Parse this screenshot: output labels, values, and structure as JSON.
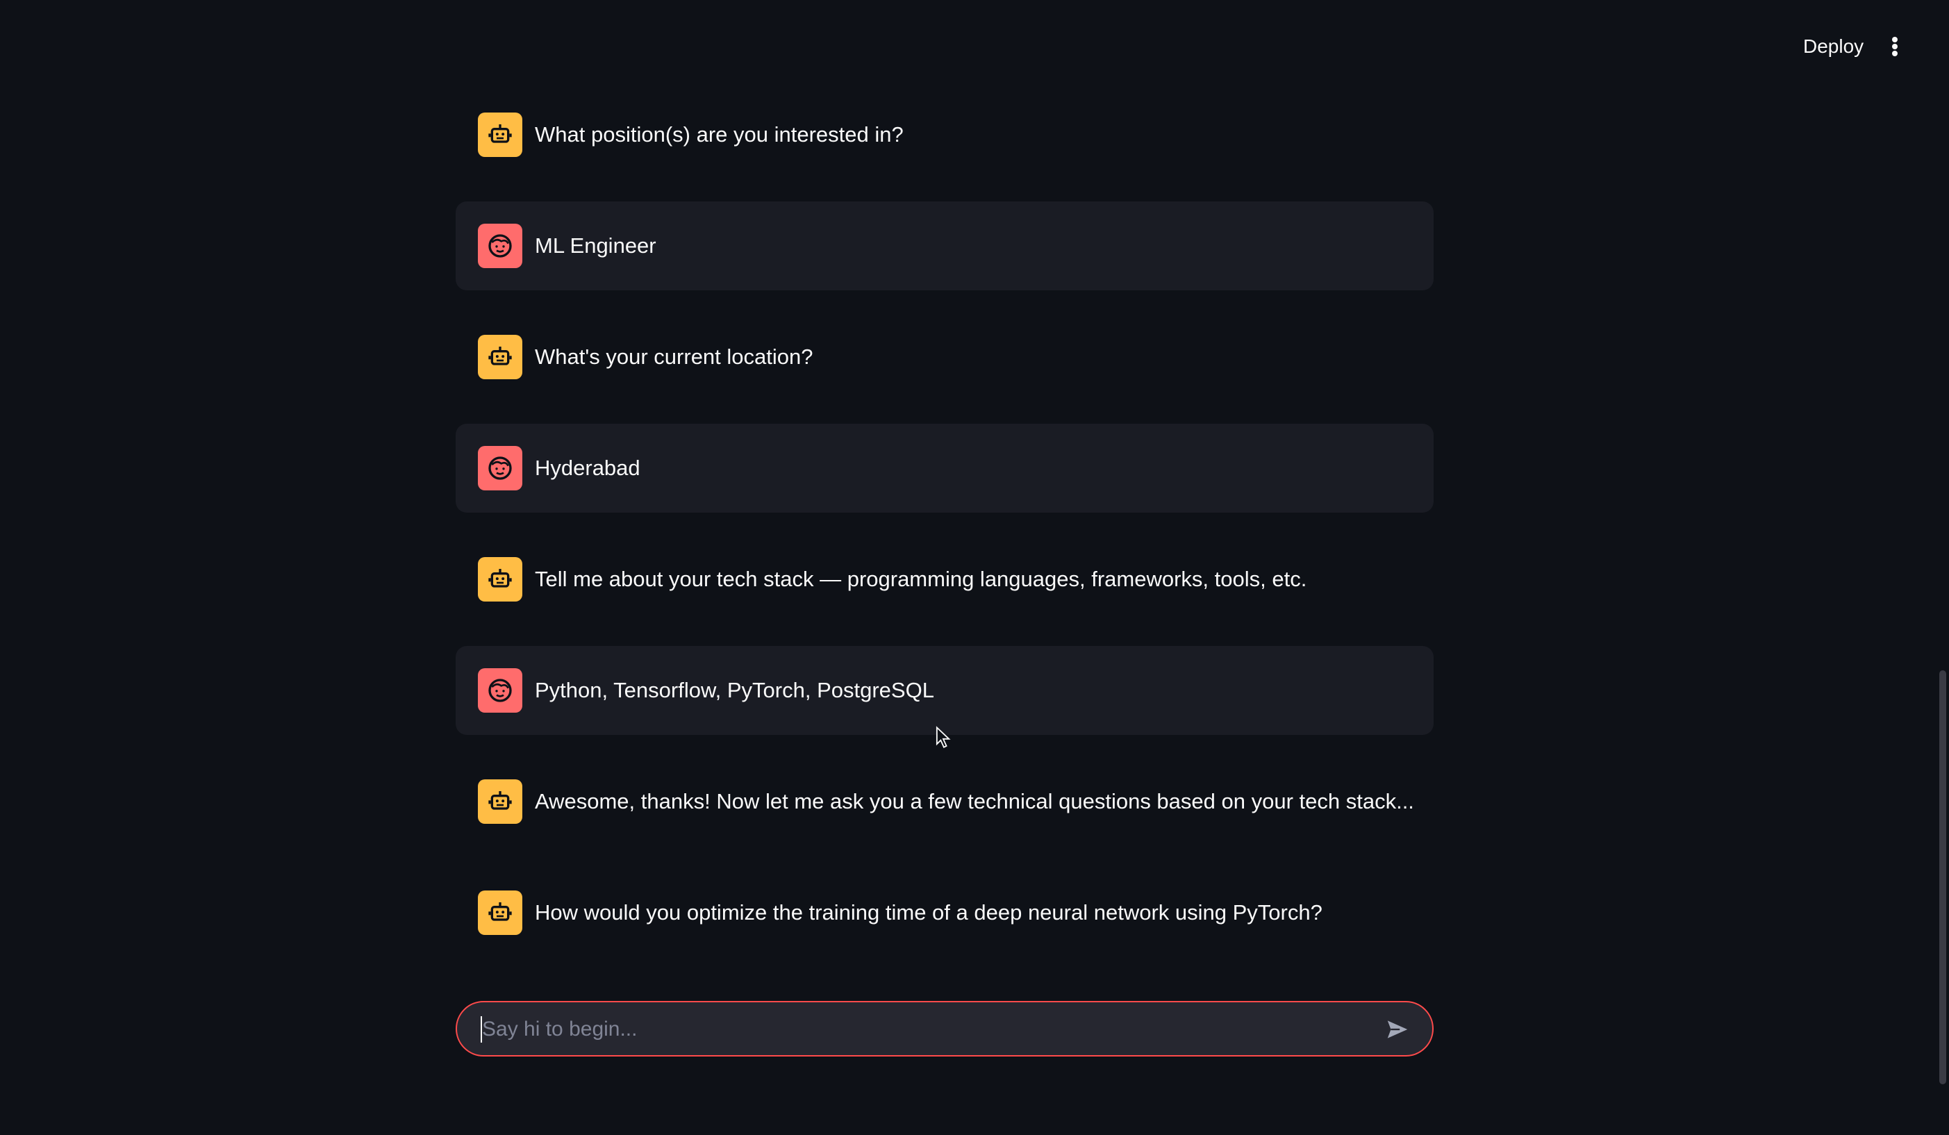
{
  "header": {
    "deploy_label": "Deploy",
    "menu_icon": "kebab-menu-icon"
  },
  "messages": [
    {
      "role": "assistant",
      "avatar_icon": "robot-icon",
      "text": "What position(s) are you interested in?"
    },
    {
      "role": "user",
      "avatar_icon": "smiley-face-icon",
      "text": "ML Engineer"
    },
    {
      "role": "assistant",
      "avatar_icon": "robot-icon",
      "text": "What's your current location?"
    },
    {
      "role": "user",
      "avatar_icon": "smiley-face-icon",
      "text": "Hyderabad"
    },
    {
      "role": "assistant",
      "avatar_icon": "robot-icon",
      "text": "Tell me about your tech stack — programming languages, frameworks, tools, etc."
    },
    {
      "role": "user",
      "avatar_icon": "smiley-face-icon",
      "text": "Python, Tensorflow, PyTorch, PostgreSQL"
    },
    {
      "role": "assistant",
      "avatar_icon": "robot-icon",
      "text": "Awesome, thanks! Now let me ask you a few technical questions based on your tech stack..."
    },
    {
      "role": "assistant",
      "avatar_icon": "robot-icon",
      "text": "How would you optimize the training time of a deep neural network using PyTorch?"
    }
  ],
  "chat_input": {
    "value": "",
    "placeholder": "Say hi to begin...",
    "send_icon": "send-icon"
  },
  "colors": {
    "background": "#0e1117",
    "user_bubble": "#1a1c24",
    "assistant_avatar": "#ffbd45",
    "user_avatar": "#ff6c6c",
    "input_border": "#ff4b4b",
    "input_bg": "#262730"
  }
}
